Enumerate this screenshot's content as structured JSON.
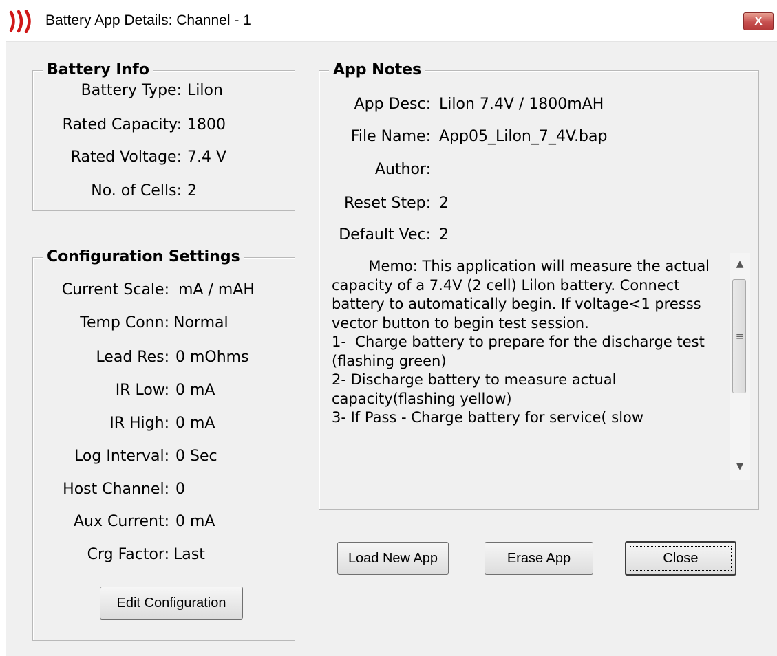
{
  "window": {
    "title": "Battery App Details: Channel - 1",
    "close_glyph": "X",
    "icon": "speaker-waves-icon"
  },
  "battery_info": {
    "title": "Battery Info",
    "fields": [
      {
        "label": "Battery Type:",
        "value": "Lilon"
      },
      {
        "label": "Rated Capacity:",
        "value": "1800"
      },
      {
        "label": "Rated Voltage:",
        "value": "7.4 V"
      },
      {
        "label": "No. of Cells:",
        "value": "2"
      }
    ]
  },
  "config": {
    "title": "Configuration Settings",
    "fields": [
      {
        "label": "Current Scale:",
        "value": "mA / mAH"
      },
      {
        "label": "Temp Conn:",
        "value": "Normal"
      },
      {
        "label": "Lead Res:",
        "value": "0  mOhms"
      },
      {
        "label": "IR Low:",
        "value": "0  mA"
      },
      {
        "label": "IR High:",
        "value": "0  mA"
      },
      {
        "label": "Log Interval:",
        "value": "0  Sec"
      },
      {
        "label": "Host Channel:",
        "value": "0"
      },
      {
        "label": "Aux Current:",
        "value": "0  mA"
      },
      {
        "label": "Crg Factor:",
        "value": "Last"
      }
    ],
    "edit_button": "Edit Configuration"
  },
  "app_notes": {
    "title": "App Notes",
    "fields": [
      {
        "label": "App Desc:",
        "value": "Lilon 7.4V / 1800mAH"
      },
      {
        "label": "File Name:",
        "value": "App05_Lilon_7_4V.bap"
      },
      {
        "label": "Author:",
        "value": ""
      },
      {
        "label": "Reset Step:",
        "value": "2"
      },
      {
        "label": "Default Vec:",
        "value": "2"
      }
    ],
    "memo": "        Memo: This application will measure the actual capacity of a 7.4V (2 cell) Lilon battery. Connect battery to automatically begin. If voltage<1 presss vector button to begin test session.\n1-  Charge battery to prepare for the discharge test (flashing green)\n2- Discharge battery to measure actual capacity(flashing yellow)\n3- If Pass - Charge battery for service( slow"
  },
  "buttons": {
    "load": "Load New App",
    "erase": "Erase App",
    "close": "Close"
  },
  "colors": {
    "window_bg": "#f0f0f0",
    "icon_red": "#d01818",
    "close_button": "#c75050"
  }
}
